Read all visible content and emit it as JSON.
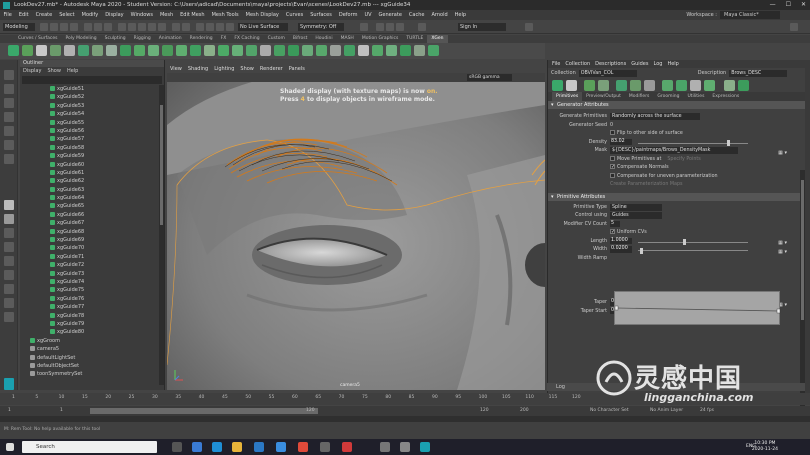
{
  "window": {
    "title": "LookDev27.mb* - Autodesk Maya 2020 - Student Version: C:\\Users\\adicad\\Documents\\maya\\projects\\Evan\\scenes\\LookDev27.mb  ---  xgGuide34",
    "controls": [
      "—",
      "☐",
      "✕"
    ]
  },
  "menubar": {
    "items": [
      "File",
      "Edit",
      "Create",
      "Select",
      "Modify",
      "Display",
      "Windows",
      "Mesh",
      "Edit Mesh",
      "Mesh Tools",
      "Mesh Display",
      "Curves",
      "Surfaces",
      "Deform",
      "UV",
      "Generate",
      "Cache",
      "Arnold",
      "Help"
    ],
    "workspace_label": "Workspace :",
    "workspace_value": "Maya Classic*"
  },
  "statusline": {
    "mode": "Modeling",
    "live_surface": "No Live Surface",
    "symmetry": "Symmetry: Off",
    "sign_in": "Sign In"
  },
  "shelf": {
    "tabs": [
      "Curves / Surfaces",
      "Poly Modeling",
      "Sculpting",
      "Rigging",
      "Animation",
      "Rendering",
      "FX",
      "FX Caching",
      "Custom",
      "Bifrost",
      "Houdini",
      "MASH",
      "Motion Graphics",
      "TURTLE",
      "XGen"
    ],
    "active_tab": "XGen"
  },
  "outliner": {
    "title": "Outliner",
    "menu": [
      "Display",
      "Show",
      "Help"
    ],
    "items": [
      {
        "label": "xgGuide51",
        "icon": "guide"
      },
      {
        "label": "xgGuide52",
        "icon": "guide"
      },
      {
        "label": "xgGuide53",
        "icon": "guide"
      },
      {
        "label": "xgGuide54",
        "icon": "guide"
      },
      {
        "label": "xgGuide55",
        "icon": "guide"
      },
      {
        "label": "xgGuide56",
        "icon": "guide"
      },
      {
        "label": "xgGuide57",
        "icon": "guide"
      },
      {
        "label": "xgGuide58",
        "icon": "guide"
      },
      {
        "label": "xgGuide59",
        "icon": "guide"
      },
      {
        "label": "xgGuide60",
        "icon": "guide"
      },
      {
        "label": "xgGuide61",
        "icon": "guide"
      },
      {
        "label": "xgGuide62",
        "icon": "guide"
      },
      {
        "label": "xgGuide63",
        "icon": "guide"
      },
      {
        "label": "xgGuide64",
        "icon": "guide"
      },
      {
        "label": "xgGuide65",
        "icon": "guide"
      },
      {
        "label": "xgGuide66",
        "icon": "guide"
      },
      {
        "label": "xgGuide67",
        "icon": "guide"
      },
      {
        "label": "xgGuide68",
        "icon": "guide"
      },
      {
        "label": "xgGuide69",
        "icon": "guide"
      },
      {
        "label": "xgGuide70",
        "icon": "guide"
      },
      {
        "label": "xgGuide71",
        "icon": "guide"
      },
      {
        "label": "xgGuide72",
        "icon": "guide"
      },
      {
        "label": "xgGuide73",
        "icon": "guide"
      },
      {
        "label": "xgGuide74",
        "icon": "guide"
      },
      {
        "label": "xgGuide75",
        "icon": "guide"
      },
      {
        "label": "xgGuide76",
        "icon": "guide"
      },
      {
        "label": "xgGuide77",
        "icon": "guide"
      },
      {
        "label": "xgGuide78",
        "icon": "guide"
      },
      {
        "label": "xgGuide79",
        "icon": "guide"
      },
      {
        "label": "xgGuide80",
        "icon": "guide"
      },
      {
        "label": "xgGroom",
        "icon": "group"
      },
      {
        "label": "camera5",
        "icon": "camera"
      },
      {
        "label": "defaultLightSet",
        "icon": "set"
      },
      {
        "label": "defaultObjectSet",
        "icon": "set"
      },
      {
        "label": "toonSymmetrySet",
        "icon": "set"
      }
    ]
  },
  "viewport": {
    "menu": [
      "View",
      "Shading",
      "Lighting",
      "Show",
      "Renderer",
      "Panels"
    ],
    "color_space": "sRGB gamma",
    "hud_line1_a": "Shaded display (with texture maps) is now ",
    "hud_line1_b": "on.",
    "hud_line2_a": "Press ",
    "hud_line2_b": "4",
    "hud_line2_c": " to display objects in wireframe mode.",
    "camera": "camera5"
  },
  "attribute_editor": {
    "menu": [
      "File",
      "Collection",
      "Descriptions",
      "Guides",
      "Log",
      "Help"
    ],
    "collection_label": "Collection",
    "collection_value": "OBVIVan_COL",
    "description_label": "Description",
    "description_value": "Brows_DESC",
    "tabs": [
      "Primitives",
      "Preview/Output",
      "Modifiers",
      "Grooming",
      "Utilities",
      "Expressions"
    ],
    "active_tab": "Primitives",
    "generator": {
      "section": "Generator Attributes",
      "generate_primitives_label": "Generate Primitives",
      "generate_primitives_value": "Randomly across the surface",
      "seed_label": "Generator Seed",
      "seed_value": "0",
      "flip_label": "Flip to other side of surface",
      "density_label": "Density",
      "density_value": "83.02",
      "density_fraction": 0.83,
      "mask_label": "Mask",
      "mask_value": "${DESC}/paintmaps/Brows_DensityMask",
      "move_label": "Move Primitives at",
      "specify_label": "Specify Points",
      "compensate_normals": "Compensate Normals",
      "compensate_uneven": "Compensate for uneven parameterization",
      "create_param": "Create Parameterization Maps"
    },
    "primitive": {
      "section": "Primitive Attributes",
      "type_label": "Primitive Type",
      "type_value": "Spline",
      "control_label": "Control using",
      "control_value": "Guides",
      "modifier_cvs_label": "Modifier CV Count",
      "modifier_cvs_value": "5",
      "uniform_cvs": "Uniform CVs",
      "length_label": "Length",
      "length_value": "1.0000",
      "width_label": "Width",
      "width_value": "0.0200",
      "width_ramp_label": "Width Ramp",
      "interpolation_label": "Interpolation",
      "interpolation_value": "Linear",
      "value_label": "Value",
      "value_value": "0.434",
      "position_label": "Position",
      "position_value": "1.000",
      "taper_label": "Taper",
      "taper_value": "0.0000",
      "taper_start_label": "Taper Start",
      "taper_start_value": "0.0000"
    },
    "log": "Log"
  },
  "timeline": {
    "ticks": [
      "1",
      "5",
      "10",
      "15",
      "20",
      "25",
      "30",
      "35",
      "40",
      "45",
      "50",
      "55",
      "60",
      "65",
      "70",
      "75",
      "80",
      "85",
      "90",
      "95",
      "100",
      "105",
      "110",
      "115",
      "120"
    ],
    "range_start": "1",
    "range_start2": "1",
    "range_end_inner": "120",
    "range_end": "120",
    "range_end2": "200",
    "character_set": "No Character Set",
    "anim_layer": "No Anim Layer",
    "fps": "24 fps"
  },
  "help_line": "M: Rem Tool: No help available for this tool",
  "taskbar": {
    "search": "Search",
    "lang": "ENG",
    "time": "10:30 PM",
    "date": "2020-11-24"
  },
  "watermark": {
    "cn": "灵感中国",
    "en": "lingganchina.com"
  }
}
